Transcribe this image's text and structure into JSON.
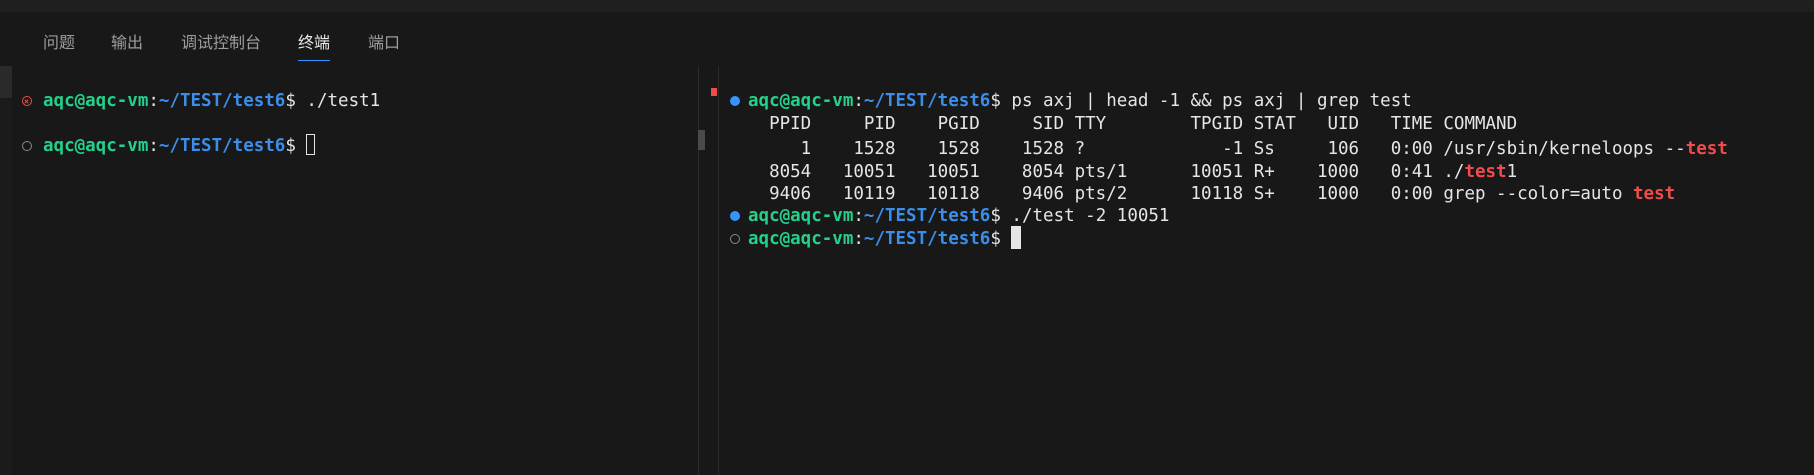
{
  "panel_tabs": [
    {
      "label": "问题"
    },
    {
      "label": "输出"
    },
    {
      "label": "调试控制台"
    },
    {
      "label": "终端",
      "active": true
    },
    {
      "label": "端口"
    }
  ],
  "left_terminal": {
    "lines": [
      {
        "user": "aqc@aqc-vm",
        "sep": ":",
        "path": "~/TEST/test6",
        "prompt": "$ ",
        "command": "./test1"
      },
      {
        "user": "aqc@aqc-vm",
        "sep": ":",
        "path": "~/TEST/test6",
        "prompt": "$ ",
        "command": ""
      }
    ]
  },
  "right_terminal": {
    "cmd1": {
      "user": "aqc@aqc-vm",
      "sep": ":",
      "path": "~/TEST/test6",
      "prompt": "$ ",
      "command": "ps axj | head -1 && ps axj | grep test"
    },
    "header": "  PPID     PID    PGID     SID TTY        TPGID STAT   UID   TIME COMMAND",
    "rows": [
      {
        "pre": "     1    1528    1528    1528 ?             -1 Ss     106   0:00 /usr/sbin/kerneloops --",
        "match": "test",
        "post": ""
      },
      {
        "pre": "  8054   10051   10051    8054 pts/1      10051 R+    1000   0:41 ./",
        "match": "test",
        "post": "1"
      },
      {
        "pre": "  9406   10119   10118    9406 pts/2      10118 S+    1000   0:00 grep --color=auto ",
        "match": "test",
        "post": ""
      }
    ],
    "cmd2": {
      "user": "aqc@aqc-vm",
      "sep": ":",
      "path": "~/TEST/test6",
      "prompt": "$ ",
      "command": "./test -2 10051"
    },
    "cmd3": {
      "user": "aqc@aqc-vm",
      "sep": ":",
      "path": "~/TEST/test6",
      "prompt": "$ ",
      "command": ""
    }
  },
  "colors": {
    "user": "#23d18b",
    "path": "#3b8eea",
    "match": "#f14c4c",
    "success_dot": "#3794ff",
    "error_dot": "#f14c4c"
  },
  "icons": {
    "error": "circle-x-icon",
    "success": "filled-circle-icon",
    "pending": "hollow-circle-icon"
  }
}
